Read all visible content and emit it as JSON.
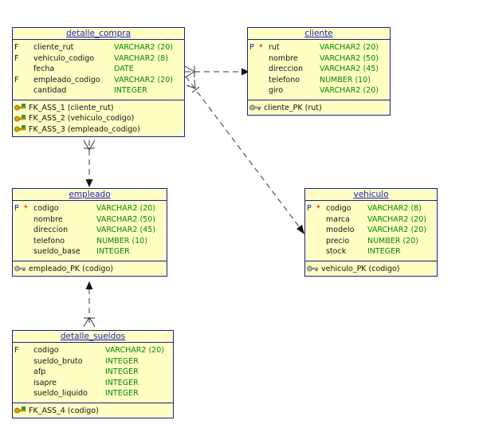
{
  "colors": {
    "entity_bg": "#ffffc4",
    "entity_border": "#1d1d8f",
    "title": "#1a1ac9",
    "type": "#008800",
    "mandatory": "#d40000"
  },
  "entities": {
    "detalle_compra": {
      "title": "detalle_compra",
      "columns": [
        {
          "flag": "F",
          "mandatory": "",
          "name": "cliente_rut",
          "type": "VARCHAR2 (20)"
        },
        {
          "flag": "F",
          "mandatory": "",
          "name": "vehiculo_codigo",
          "type": "VARCHAR2 (8)"
        },
        {
          "flag": "",
          "mandatory": "",
          "name": "fecha",
          "type": "DATE"
        },
        {
          "flag": "F",
          "mandatory": "",
          "name": "empleado_codigo",
          "type": "VARCHAR2 (20)"
        },
        {
          "flag": "",
          "mandatory": "",
          "name": "cantidad",
          "type": "INTEGER"
        }
      ],
      "keys": [
        {
          "icon": "foreign-key-icon",
          "label": "FK_ASS_1 (cliente_rut)"
        },
        {
          "icon": "foreign-key-icon",
          "label": "FK_ASS_2 (vehiculo_codigo)"
        },
        {
          "icon": "foreign-key-icon",
          "label": "FK_ASS_3 (empleado_codigo)"
        }
      ]
    },
    "cliente": {
      "title": "cliente",
      "columns": [
        {
          "flag": "P",
          "mandatory": "*",
          "name": "rut",
          "type": "VARCHAR2 (20)"
        },
        {
          "flag": "",
          "mandatory": "",
          "name": "nombre",
          "type": "VARCHAR2 (50)"
        },
        {
          "flag": "",
          "mandatory": "",
          "name": "direccion",
          "type": "VARCHAR2 (45)"
        },
        {
          "flag": "",
          "mandatory": "",
          "name": "telefono",
          "type": "NUMBER (10)"
        },
        {
          "flag": "",
          "mandatory": "",
          "name": "giro",
          "type": "VARCHAR2 (20)"
        }
      ],
      "keys": [
        {
          "icon": "primary-key-icon",
          "label": "cliente_PK (rut)"
        }
      ]
    },
    "empleado": {
      "title": "empleado",
      "columns": [
        {
          "flag": "P",
          "mandatory": "*",
          "name": "codigo",
          "type": "VARCHAR2 (20)"
        },
        {
          "flag": "",
          "mandatory": "",
          "name": "nombre",
          "type": "VARCHAR2 (50)"
        },
        {
          "flag": "",
          "mandatory": "",
          "name": "direccion",
          "type": "VARCHAR2 (45)"
        },
        {
          "flag": "",
          "mandatory": "",
          "name": "telefono",
          "type": "NUMBER (10)"
        },
        {
          "flag": "",
          "mandatory": "",
          "name": "sueldo_base",
          "type": "INTEGER"
        }
      ],
      "keys": [
        {
          "icon": "primary-key-icon",
          "label": "empleado_PK (codigo)"
        }
      ]
    },
    "vehiculo": {
      "title": "vehiculo",
      "columns": [
        {
          "flag": "P",
          "mandatory": "*",
          "name": "codigo",
          "type": "VARCHAR2 (8)"
        },
        {
          "flag": "",
          "mandatory": "",
          "name": "marca",
          "type": "VARCHAR2 (20)"
        },
        {
          "flag": "",
          "mandatory": "",
          "name": "modelo",
          "type": "VARCHAR2 (20)"
        },
        {
          "flag": "",
          "mandatory": "",
          "name": "precio",
          "type": "NUMBER (20)"
        },
        {
          "flag": "",
          "mandatory": "",
          "name": "stock",
          "type": "INTEGER"
        }
      ],
      "keys": [
        {
          "icon": "primary-key-icon",
          "label": "vehiculo_PK (codigo)"
        }
      ]
    },
    "detalle_sueldos": {
      "title": "detalle_sueldos",
      "columns": [
        {
          "flag": "F",
          "mandatory": "",
          "name": "codigo",
          "type": "VARCHAR2 (20)"
        },
        {
          "flag": "",
          "mandatory": "",
          "name": "sueldo_bruto",
          "type": "INTEGER"
        },
        {
          "flag": "",
          "mandatory": "",
          "name": "afp",
          "type": "INTEGER"
        },
        {
          "flag": "",
          "mandatory": "",
          "name": "isapre",
          "type": "INTEGER"
        },
        {
          "flag": "",
          "mandatory": "",
          "name": "sueldo_liquido",
          "type": "INTEGER"
        }
      ],
      "keys": [
        {
          "icon": "foreign-key-icon",
          "label": "FK_ASS_4 (codigo)"
        }
      ]
    }
  },
  "relationships": [
    {
      "from": "detalle_compra",
      "to": "cliente",
      "label": "FK_ASS_1"
    },
    {
      "from": "detalle_compra",
      "to": "vehiculo",
      "label": "FK_ASS_2"
    },
    {
      "from": "detalle_compra",
      "to": "empleado",
      "label": "FK_ASS_3"
    },
    {
      "from": "detalle_sueldos",
      "to": "empleado",
      "label": "FK_ASS_4"
    }
  ]
}
